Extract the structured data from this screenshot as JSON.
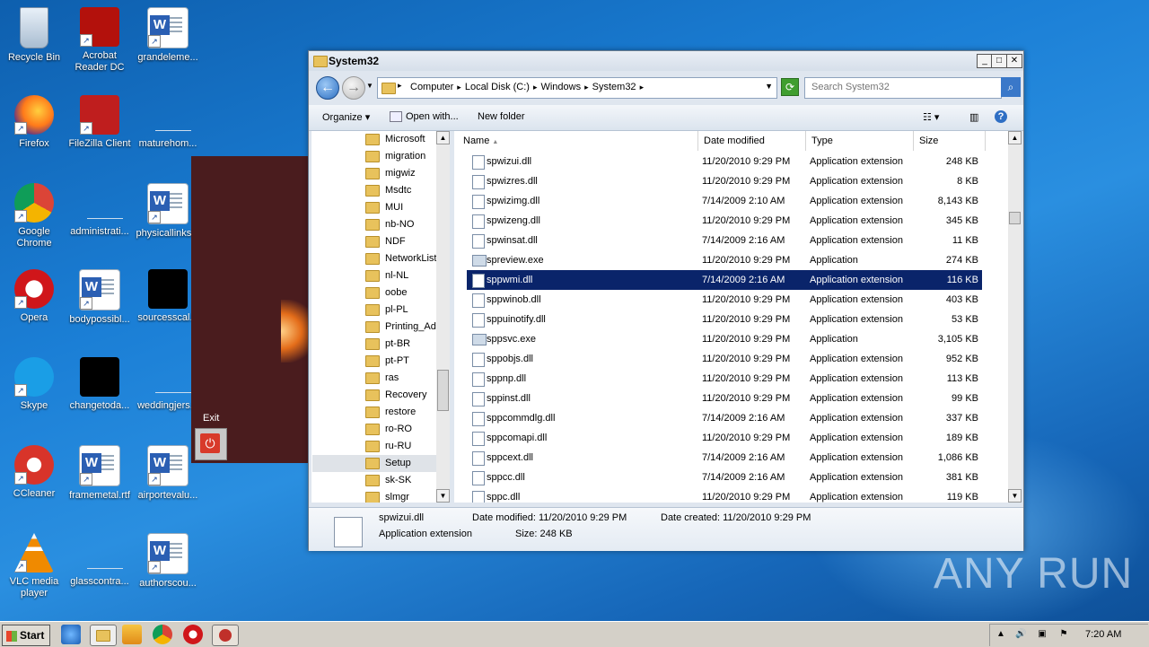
{
  "desktop": {
    "icons": [
      {
        "label": "Recycle Bin",
        "icon": "recycle-bin-icon"
      },
      {
        "label": "Acrobat Reader DC",
        "icon": "acrobat-icon"
      },
      {
        "label": "grandeleme...",
        "icon": "word-doc-icon"
      },
      {
        "label": "Firefox",
        "icon": "firefox-icon"
      },
      {
        "label": "FileZilla Client",
        "icon": "filezilla-icon"
      },
      {
        "label": "maturehom...",
        "icon": "blank-file-icon"
      },
      {
        "label": "Google Chrome",
        "icon": "chrome-icon"
      },
      {
        "label": "administrati...",
        "icon": "blank-file-icon"
      },
      {
        "label": "physicallinks...",
        "icon": "word-doc-icon"
      },
      {
        "label": "Opera",
        "icon": "opera-icon"
      },
      {
        "label": "bodypossibl...",
        "icon": "word-doc-icon"
      },
      {
        "label": "sourcesscal...",
        "icon": "black-file-icon"
      },
      {
        "label": "Skype",
        "icon": "skype-icon"
      },
      {
        "label": "changetoda...",
        "icon": "black-file-icon"
      },
      {
        "label": "weddingjers...",
        "icon": "blank-file-icon"
      },
      {
        "label": "CCleaner",
        "icon": "ccleaner-icon"
      },
      {
        "label": "framemetal.rtf",
        "icon": "word-doc-icon"
      },
      {
        "label": "airportevalu...",
        "icon": "word-doc-icon"
      },
      {
        "label": "VLC media player",
        "icon": "vlc-icon"
      },
      {
        "label": "glasscontra...",
        "icon": "blank-file-icon"
      },
      {
        "label": "authorscou...",
        "icon": "word-doc-icon"
      }
    ],
    "exit_label": "Exit",
    "watermark": "ANY RUN"
  },
  "window": {
    "title": "System32",
    "breadcrumbs": [
      "Computer",
      "Local Disk (C:)",
      "Windows",
      "System32"
    ],
    "search_placeholder": "Search System32",
    "toolbar": {
      "organize": "Organize",
      "open_with": "Open with...",
      "new_folder": "New folder"
    },
    "nav_items": [
      "Microsoft",
      "migration",
      "migwiz",
      "Msdtc",
      "MUI",
      "nb-NO",
      "NDF",
      "NetworkList",
      "nl-NL",
      "oobe",
      "pl-PL",
      "Printing_Adm",
      "pt-BR",
      "pt-PT",
      "ras",
      "Recovery",
      "restore",
      "ro-RO",
      "ru-RU",
      "Setup",
      "sk-SK",
      "slmgr"
    ],
    "nav_selected": "Setup",
    "columns": [
      "Name",
      "Date modified",
      "Type",
      "Size"
    ],
    "files": [
      {
        "name": "spwizui.dll",
        "date": "11/20/2010 9:29 PM",
        "type": "Application extension",
        "size": "248 KB"
      },
      {
        "name": "spwizres.dll",
        "date": "11/20/2010 9:29 PM",
        "type": "Application extension",
        "size": "8 KB"
      },
      {
        "name": "spwizimg.dll",
        "date": "7/14/2009 2:10 AM",
        "type": "Application extension",
        "size": "8,143 KB"
      },
      {
        "name": "spwizeng.dll",
        "date": "11/20/2010 9:29 PM",
        "type": "Application extension",
        "size": "345 KB"
      },
      {
        "name": "spwinsat.dll",
        "date": "7/14/2009 2:16 AM",
        "type": "Application extension",
        "size": "11 KB"
      },
      {
        "name": "spreview.exe",
        "date": "11/20/2010 9:29 PM",
        "type": "Application",
        "size": "274 KB"
      },
      {
        "name": "sppwmi.dll",
        "date": "7/14/2009 2:16 AM",
        "type": "Application extension",
        "size": "116 KB"
      },
      {
        "name": "sppwinob.dll",
        "date": "11/20/2010 9:29 PM",
        "type": "Application extension",
        "size": "403 KB"
      },
      {
        "name": "sppuinotify.dll",
        "date": "11/20/2010 9:29 PM",
        "type": "Application extension",
        "size": "53 KB"
      },
      {
        "name": "sppsvc.exe",
        "date": "11/20/2010 9:29 PM",
        "type": "Application",
        "size": "3,105 KB"
      },
      {
        "name": "sppobjs.dll",
        "date": "11/20/2010 9:29 PM",
        "type": "Application extension",
        "size": "952 KB"
      },
      {
        "name": "sppnp.dll",
        "date": "11/20/2010 9:29 PM",
        "type": "Application extension",
        "size": "113 KB"
      },
      {
        "name": "sppinst.dll",
        "date": "11/20/2010 9:29 PM",
        "type": "Application extension",
        "size": "99 KB"
      },
      {
        "name": "sppcommdlg.dll",
        "date": "7/14/2009 2:16 AM",
        "type": "Application extension",
        "size": "337 KB"
      },
      {
        "name": "sppcomapi.dll",
        "date": "11/20/2010 9:29 PM",
        "type": "Application extension",
        "size": "189 KB"
      },
      {
        "name": "sppcext.dll",
        "date": "7/14/2009 2:16 AM",
        "type": "Application extension",
        "size": "1,086 KB"
      },
      {
        "name": "sppcc.dll",
        "date": "7/14/2009 2:16 AM",
        "type": "Application extension",
        "size": "381 KB"
      },
      {
        "name": "sppc.dll",
        "date": "11/20/2010 9:29 PM",
        "type": "Application extension",
        "size": "119 KB"
      }
    ],
    "selected_file": "sppwmi.dll",
    "details": {
      "name": "spwizui.dll",
      "type": "Application extension",
      "date_modified_label": "Date modified:",
      "date_modified": "11/20/2010 9:29 PM",
      "date_created_label": "Date created:",
      "date_created": "11/20/2010 9:29 PM",
      "size_label": "Size:",
      "size": "248 KB"
    }
  },
  "taskbar": {
    "start_label": "Start",
    "clock": "7:20 AM",
    "pinned": [
      "ie-icon",
      "explorer-icon",
      "media-player-icon",
      "chrome-icon",
      "opera-icon",
      "red-app-icon"
    ]
  }
}
